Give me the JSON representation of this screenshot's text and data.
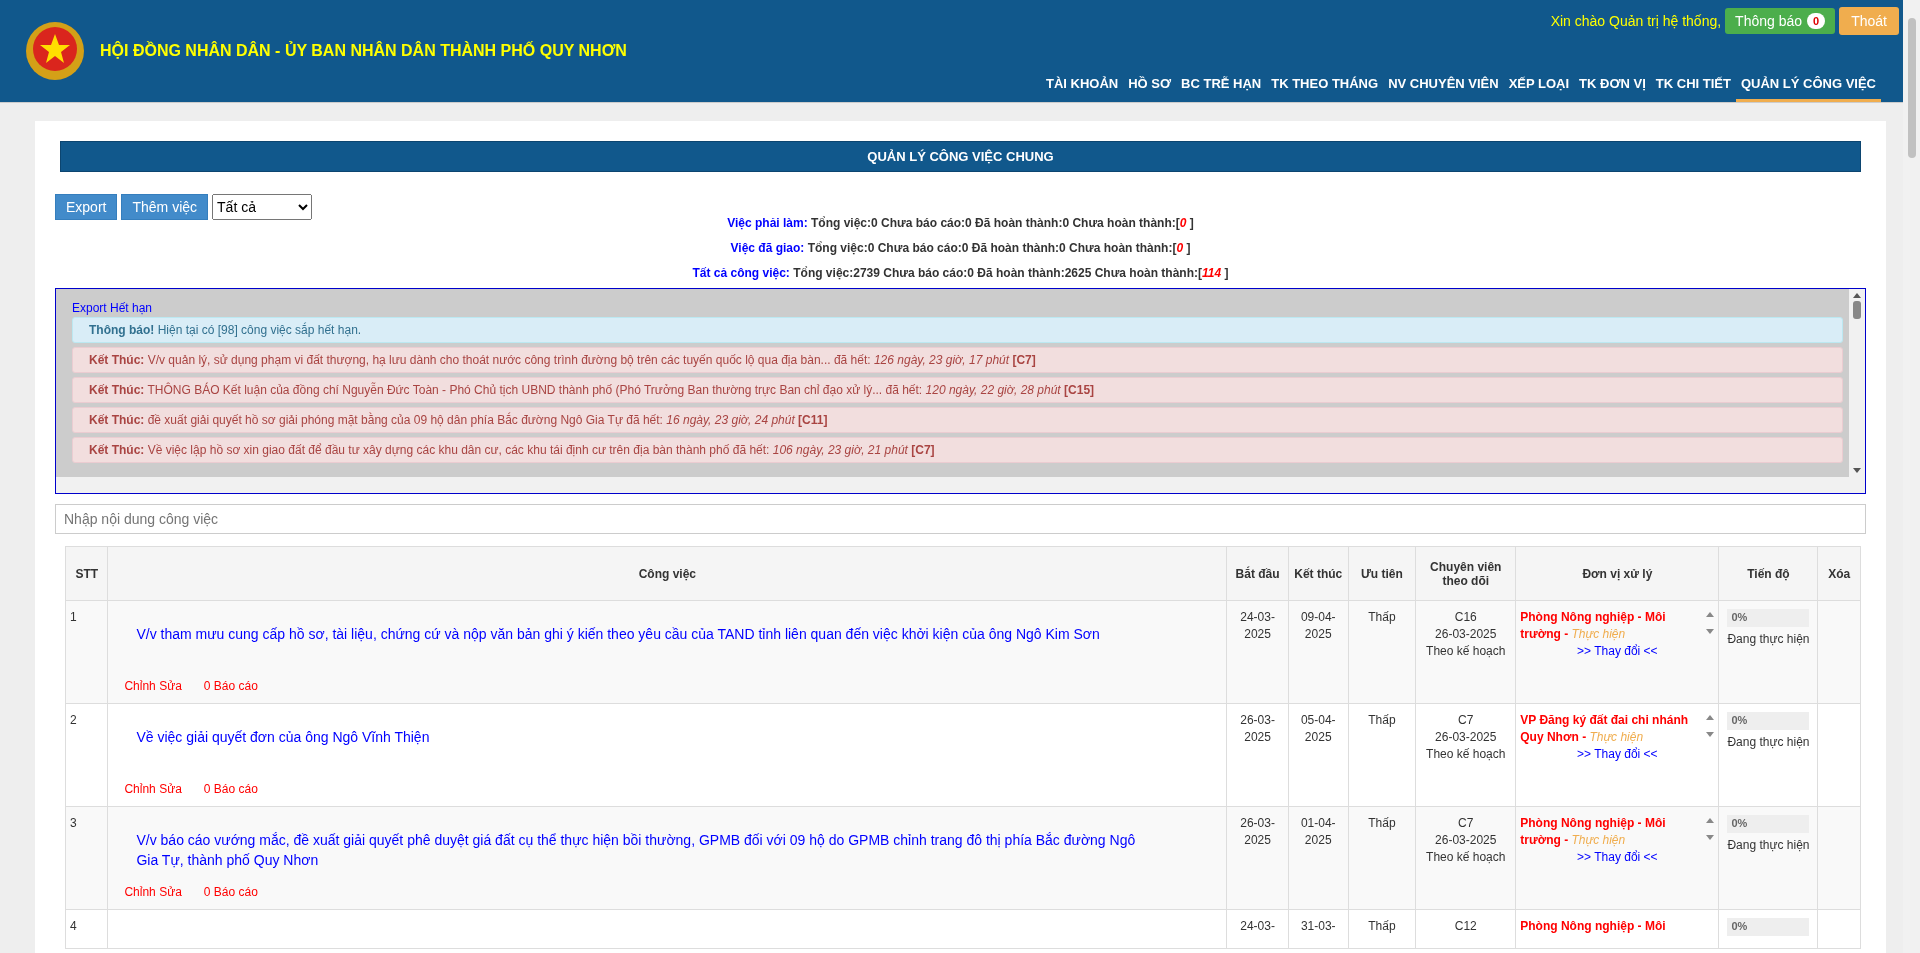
{
  "header": {
    "title": "HỘI ĐỒNG NHÂN DÂN - ỦY BAN NHÂN DÂN THÀNH PHỐ QUY NHƠN",
    "greeting": "Xin chào Quản trị hệ thống,",
    "notify_button": "Thông báo",
    "notify_count": "0",
    "logout_button": "Thoát"
  },
  "nav": [
    {
      "label": "TÀI KHOẢN",
      "selected": false
    },
    {
      "label": "HỒ SƠ",
      "selected": false
    },
    {
      "label": "BC TRỄ HẠN",
      "selected": false
    },
    {
      "label": "TK THEO THÁNG",
      "selected": false
    },
    {
      "label": "NV CHUYÊN VIÊN",
      "selected": false
    },
    {
      "label": "XẾP LOẠI",
      "selected": false
    },
    {
      "label": "TK ĐƠN VỊ",
      "selected": false
    },
    {
      "label": "TK CHI TIẾT",
      "selected": false
    },
    {
      "label": "QUẢN LÝ CÔNG VIỆC",
      "selected": true
    }
  ],
  "page_title": "QUẢN LÝ CÔNG VIỆC CHUNG",
  "toolbar": {
    "export_button": "Export",
    "add_button": "Thêm việc",
    "filter": "Tất cả"
  },
  "summary": [
    {
      "label": "Việc phải làm:",
      "stats": "Tổng việc:0 Chưa báo cáo:0 Đã hoàn thành:0 Chưa hoàn thành:[",
      "pending": "0",
      "suffix": "]"
    },
    {
      "label": "Việc đã giao:",
      "stats": "Tổng việc:0 Chưa báo cáo:0 Đã hoàn thành:0 Chưa hoàn thành:[",
      "pending": "0",
      "suffix": "]"
    },
    {
      "label": "Tất cả công việc:",
      "stats": "Tổng việc:2739 Chưa báo cáo:0 Đã hoàn thành:2625 Chưa hoàn thành:[",
      "pending": "114",
      "suffix": "]"
    }
  ],
  "alerts": {
    "export_link": "Export Hết hạn",
    "items": [
      {
        "kind": "info",
        "label": "Thông báo!",
        "text": "Hiện tại có [98] công việc sắp hết hạn."
      },
      {
        "kind": "expired",
        "label": "Kết Thúc:",
        "text": "V/v quản lý, sử dụng phạm vi đất thượng, hạ lưu dành cho thoát nước công trình đường bộ trên các tuyến quốc lộ qua địa bàn... đã hết:",
        "elapsed": "126 ngày, 23 giờ, 17 phút",
        "code": "[C7]"
      },
      {
        "kind": "expired",
        "label": "Kết Thúc:",
        "text": "THÔNG BÁO Kết luận của đồng chí Nguyễn Đức Toàn - Phó Chủ tịch UBND thành phố (Phó Trưởng Ban thường trực Ban chỉ đạo xử lý... đã hết:",
        "elapsed": "120 ngày, 22 giờ, 28 phút",
        "code": "[C15]"
      },
      {
        "kind": "expired",
        "label": "Kết Thúc:",
        "text": "đề xuất giải quyết hồ sơ giải phóng mặt bằng của 09 hộ dân phía Bắc đường Ngô Gia Tự đã hết:",
        "elapsed": "16 ngày, 23 giờ, 24 phút",
        "code": "[C11]"
      },
      {
        "kind": "expired",
        "label": "Kết Thúc:",
        "text": "Về việc lập hồ sơ xin giao đất để đầu tư xây dựng các khu dân cư, các khu tái định cư trên địa bàn thành phố đã hết:",
        "elapsed": "106 ngày, 23 giờ, 21 phút",
        "code": "[C7]"
      }
    ]
  },
  "search": {
    "placeholder": "Nhập nội dung công việc"
  },
  "table": {
    "columns": [
      "STT",
      "Công việc",
      "Bắt đầu",
      "Kết thúc",
      "Ưu tiên",
      "Chuyên viên theo dõi",
      "Đơn vị xử lý",
      "Tiến độ",
      "Xóa"
    ],
    "rows": [
      {
        "stt": "1",
        "task": "V/v tham mưu cung cấp hồ sơ, tài liệu, chứng cứ và nộp văn bản ghi ý kiến theo yêu cầu của TAND tỉnh liên quan đến việc khởi kiện của ông Ngô Kim Sơn",
        "edit": "Chỉnh Sửa",
        "reports": "0 Báo cáo",
        "start": "24-03-2025",
        "end": "09-04-2025",
        "priority": "Thấp",
        "specialist": "C16",
        "assigned": "26-03-2025",
        "plan": "Theo kế hoạch",
        "unit": "Phòng Nông nghiệp - Môi trường -",
        "unit_status": "Thực hiện",
        "change": ">> Thay đổi <<",
        "progress_label": "0%",
        "level": 0,
        "progress_status": "Đang thực hiện"
      },
      {
        "stt": "2",
        "task": "Về việc giải quyết đơn của ông Ngô Vĩnh Thiện",
        "edit": "Chỉnh Sửa",
        "reports": "0 Báo cáo",
        "start": "26-03-2025",
        "end": "05-04-2025",
        "priority": "Thấp",
        "specialist": "C7",
        "assigned": "26-03-2025",
        "plan": "Theo kế hoạch",
        "unit": "VP Đăng ký đất đai chi nhánh Quy Nhơn -",
        "unit_status": "Thực hiện",
        "change": ">> Thay đổi <<",
        "progress_label": "0%",
        "level": 0,
        "progress_status": "Đang thực hiện"
      },
      {
        "stt": "3",
        "task": "V/v báo cáo vướng mắc, đề xuất giải quyết phê duyệt giá đất cụ thể thực hiện bồi thường, GPMB đối với 09 hộ do GPMB chỉnh trang đô thị phía Bắc đường Ngô Gia Tự, thành phố Quy Nhơn",
        "edit": "Chỉnh Sửa",
        "reports": "0 Báo cáo",
        "start": "26-03-2025",
        "end": "01-04-2025",
        "priority": "Thấp",
        "specialist": "C7",
        "assigned": "26-03-2025",
        "plan": "Theo kế hoạch",
        "unit": "Phòng Nông nghiệp - Môi trường -",
        "unit_status": "Thực hiện",
        "change": ">> Thay đổi <<",
        "progress_label": "0%",
        "level": 0,
        "progress_status": "Đang thực hiện"
      },
      {
        "stt": "4",
        "start": "24-03-",
        "end": "31-03-",
        "priority": "Thấp",
        "specialist": "C12",
        "unit": "Phòng Nông nghiệp - Môi",
        "progress_label": "0%",
        "level": 0
      }
    ]
  }
}
